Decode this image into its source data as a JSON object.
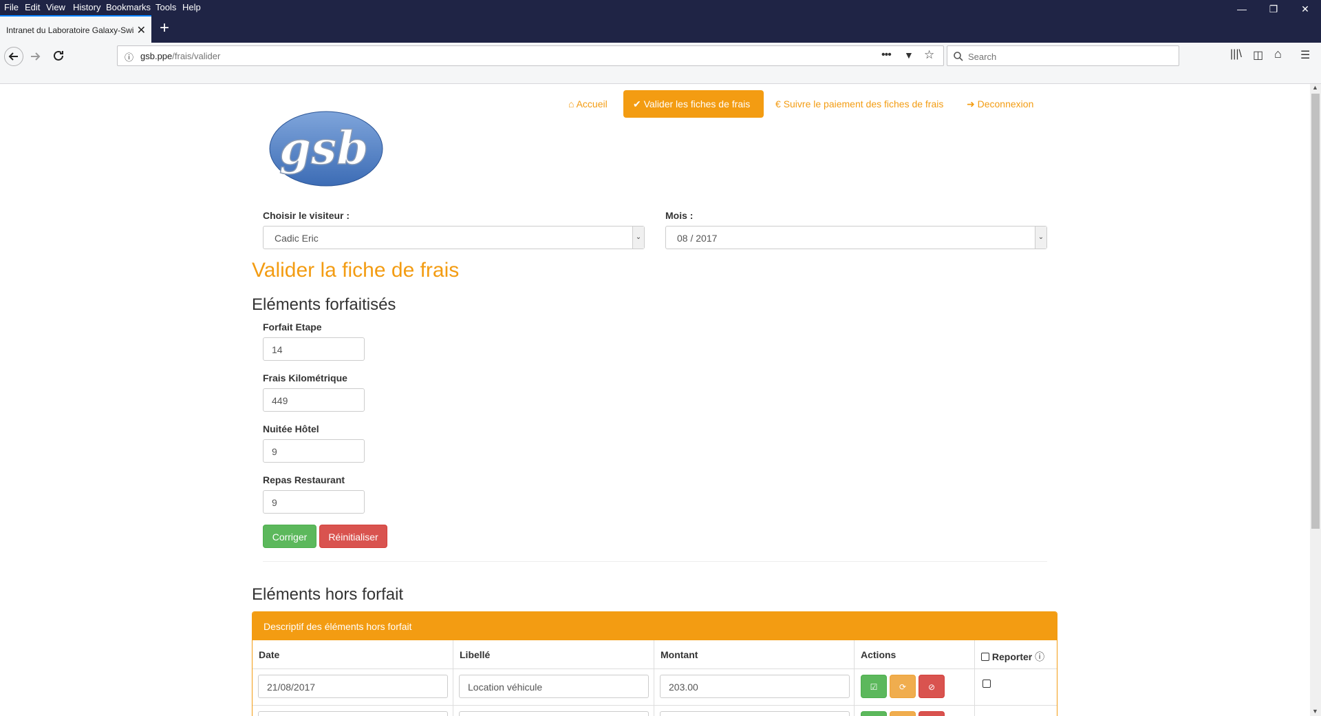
{
  "browser": {
    "menu": [
      "File",
      "Edit",
      "View",
      "History",
      "Bookmarks",
      "Tools",
      "Help"
    ],
    "tab_title": "Intranet du Laboratoire Galaxy-Swiss Bourdin",
    "url_host": "gsb.ppe",
    "url_path": "/frais/valider",
    "search_placeholder": "Search"
  },
  "nav": {
    "accueil": "Accueil",
    "valider": "Valider les fiches de frais",
    "suivre": "Suivre le paiement des fiches de frais",
    "deconnexion": "Deconnexion"
  },
  "logo_text": "gsb",
  "filters": {
    "visiteur_label": "Choisir le visiteur :",
    "visiteur_value": "Cadic Eric",
    "mois_label": "Mois :",
    "mois_value": "08 / 2017"
  },
  "page_title": "Valider la fiche de frais",
  "forfait": {
    "heading": "Eléments forfaitisés",
    "fields": [
      {
        "label": "Forfait Etape",
        "value": "14"
      },
      {
        "label": "Frais Kilométrique",
        "value": "449"
      },
      {
        "label": "Nuitée Hôtel",
        "value": "9"
      },
      {
        "label": "Repas Restaurant",
        "value": "9"
      }
    ],
    "corriger": "Corriger",
    "reinitialiser": "Réinitialiser"
  },
  "hors_forfait": {
    "heading": "Eléments hors forfait",
    "panel_title": "Descriptif des éléments hors forfait",
    "columns": [
      "Date",
      "Libellé",
      "Montant",
      "Actions",
      "Reporter"
    ],
    "rows": [
      {
        "date": "21/08/2017",
        "libelle": "Location véhicule",
        "montant": "203.00"
      },
      {
        "date": "",
        "libelle": "",
        "montant": ""
      }
    ]
  },
  "colors": {
    "brand": "#f39c12",
    "success": "#5cb85c",
    "danger": "#d9534f",
    "warning": "#f0ad4e"
  }
}
